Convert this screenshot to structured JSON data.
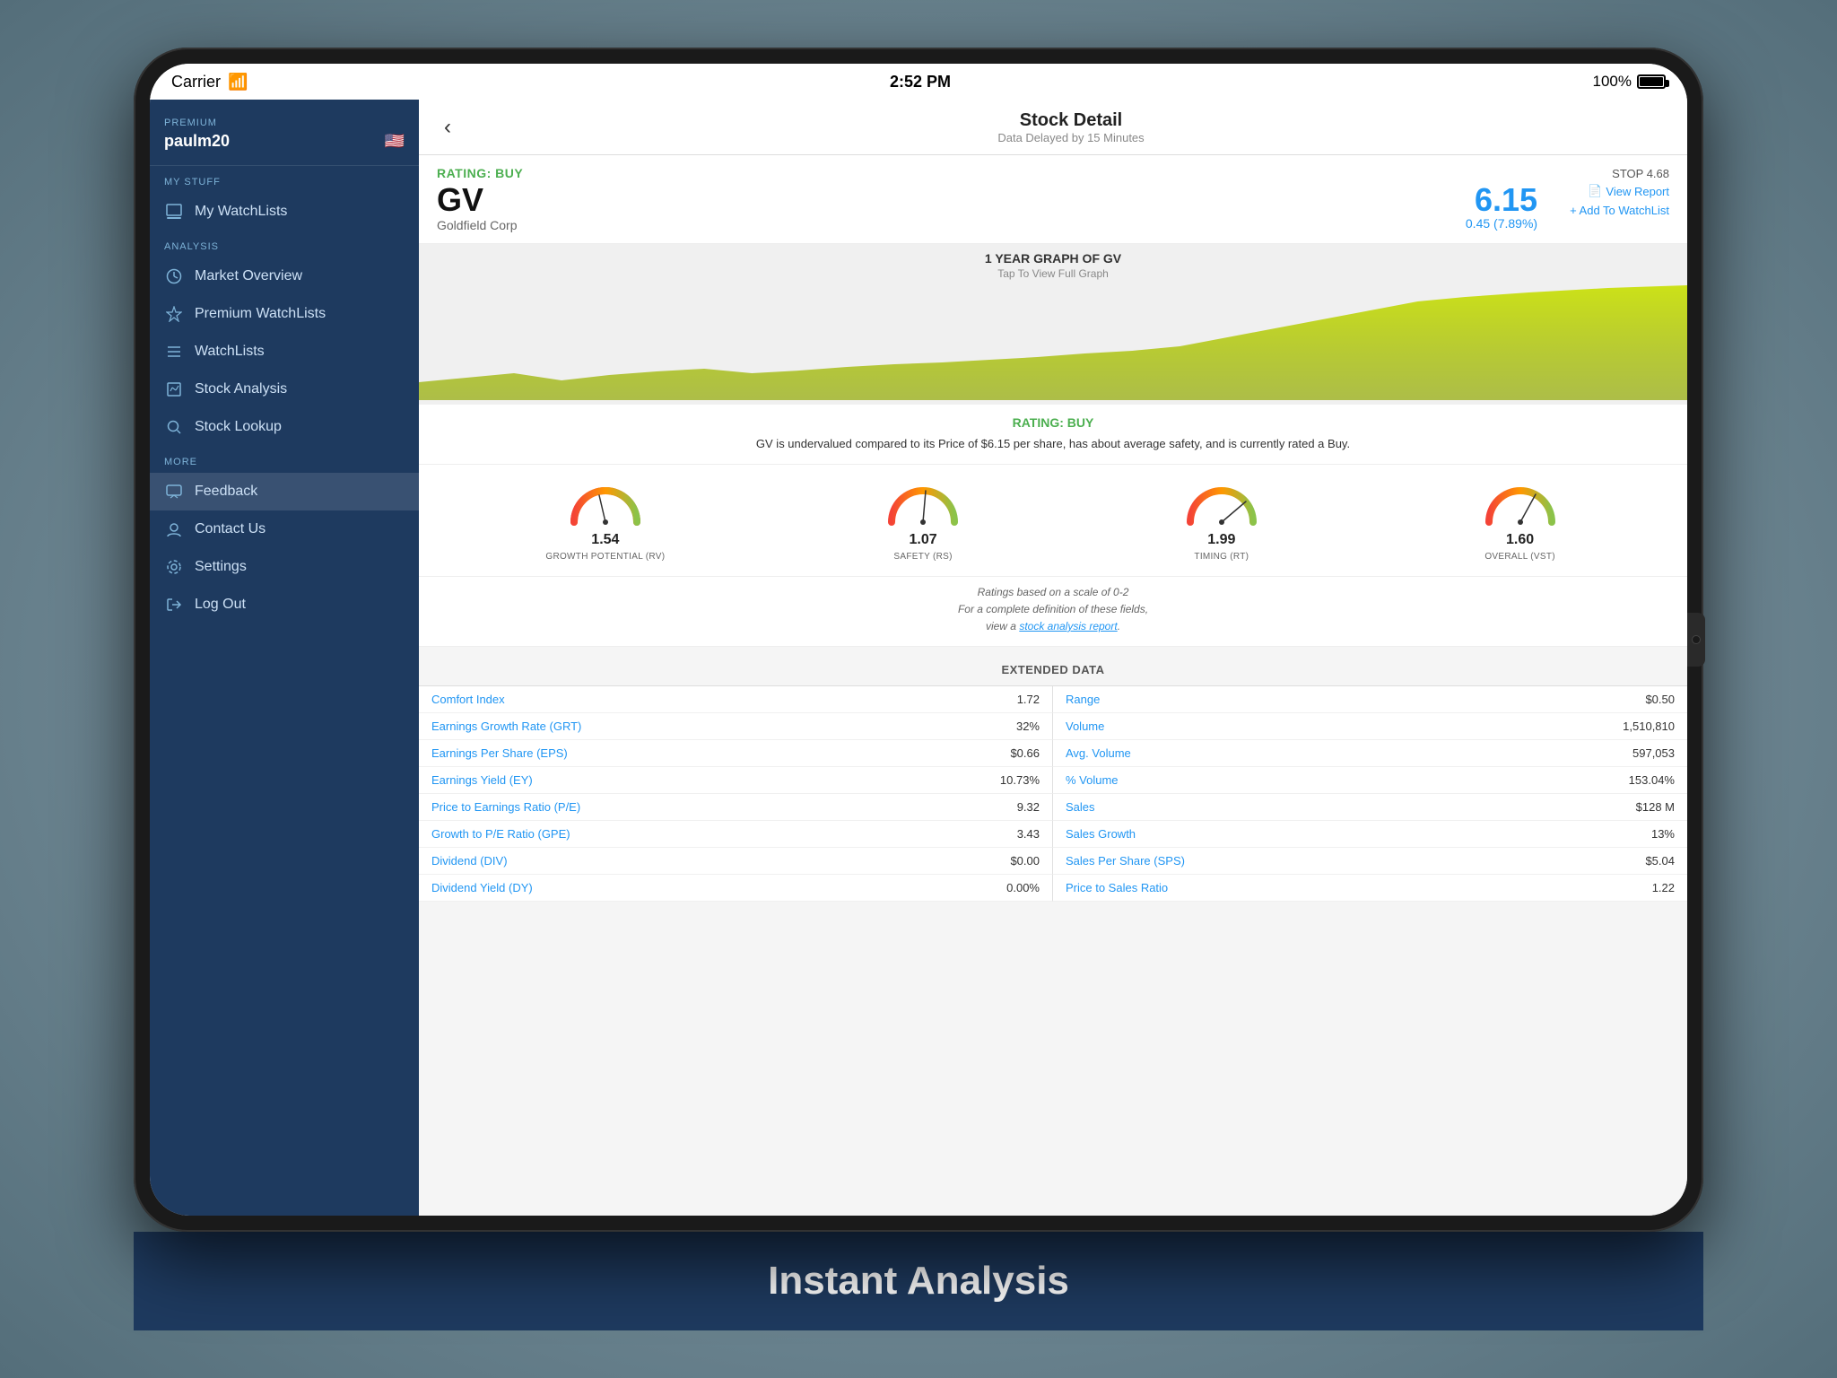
{
  "statusBar": {
    "carrier": "Carrier",
    "time": "2:52 PM",
    "battery": "100%"
  },
  "navBar": {
    "title": "Stock Detail",
    "subtitle": "Data Delayed by 15 Minutes",
    "backLabel": "‹"
  },
  "sidebar": {
    "premiumLabel": "PREMIUM",
    "username": "paulm20",
    "myStuffLabel": "MY STUFF",
    "analysisLabel": "ANALYSIS",
    "moreLabel": "MORE",
    "items": {
      "myWatchLists": "My WatchLists",
      "marketOverview": "Market Overview",
      "premiumWatchLists": "Premium WatchLists",
      "watchLists": "WatchLists",
      "stockAnalysis": "Stock Analysis",
      "stockLookup": "Stock Lookup",
      "feedback": "Feedback",
      "contactUs": "Contact Us",
      "settings": "Settings",
      "logOut": "Log Out"
    }
  },
  "stock": {
    "ratingLabel": "RATING:  BUY",
    "stopLabel": "STOP 4.68",
    "ticker": "GV",
    "company": "Goldfield Corp",
    "price": "6.15",
    "change": "0.45 (7.89%)",
    "viewReport": "View Report",
    "addToWatchList": "+ Add To WatchList"
  },
  "chart": {
    "title": "1 YEAR GRAPH OF GV",
    "subtitle": "Tap To View Full Graph"
  },
  "ratingDesc": {
    "title": "RATING:  BUY",
    "text": "GV is undervalued compared to its Price of $6.15 per share, has about average safety, and is currently rated a Buy."
  },
  "gauges": [
    {
      "id": "rv",
      "value": "1.54",
      "label": "GROWTH POTENTIAL (RV)",
      "angle": -10,
      "color": "#f57c00"
    },
    {
      "id": "rs",
      "value": "1.07",
      "label": "SAFETY (RS)",
      "angle": 5,
      "color": "#e53935"
    },
    {
      "id": "rt",
      "value": "1.99",
      "label": "TIMING (RT)",
      "angle": 80,
      "color": "#7cb342"
    },
    {
      "id": "vst",
      "value": "1.60",
      "label": "OVERALL (VST)",
      "angle": 20,
      "color": "#f57c00"
    }
  ],
  "ratingsNote": {
    "line1": "Ratings based on a scale of 0-2",
    "line2": "For a complete definition of these fields,",
    "line3": "view a ",
    "linkText": "stock analysis report",
    "line4": "."
  },
  "extendedData": {
    "header": "EXTENDED DATA",
    "leftRows": [
      {
        "label": "Comfort Index",
        "value": "1.72"
      },
      {
        "label": "Earnings Growth Rate (GRT)",
        "value": "32%"
      },
      {
        "label": "Earnings Per Share (EPS)",
        "value": "$0.66"
      },
      {
        "label": "Earnings Yield (EY)",
        "value": "10.73%"
      },
      {
        "label": "Price to Earnings Ratio (P/E)",
        "value": "9.32"
      },
      {
        "label": "Growth to P/E Ratio (GPE)",
        "value": "3.43"
      },
      {
        "label": "Dividend (DIV)",
        "value": "$0.00"
      },
      {
        "label": "Dividend Yield (DY)",
        "value": "0.00%"
      }
    ],
    "rightRows": [
      {
        "label": "Range",
        "value": "$0.50"
      },
      {
        "label": "Volume",
        "value": "1,510,810"
      },
      {
        "label": "Avg. Volume",
        "value": "597,053"
      },
      {
        "label": "% Volume",
        "value": "153.04%"
      },
      {
        "label": "Sales",
        "value": "$128 M"
      },
      {
        "label": "Sales Growth",
        "value": "13%"
      },
      {
        "label": "Sales Per Share (SPS)",
        "value": "$5.04"
      },
      {
        "label": "Price to Sales Ratio",
        "value": "1.22"
      }
    ]
  },
  "bottomLabel": "Instant Analysis"
}
